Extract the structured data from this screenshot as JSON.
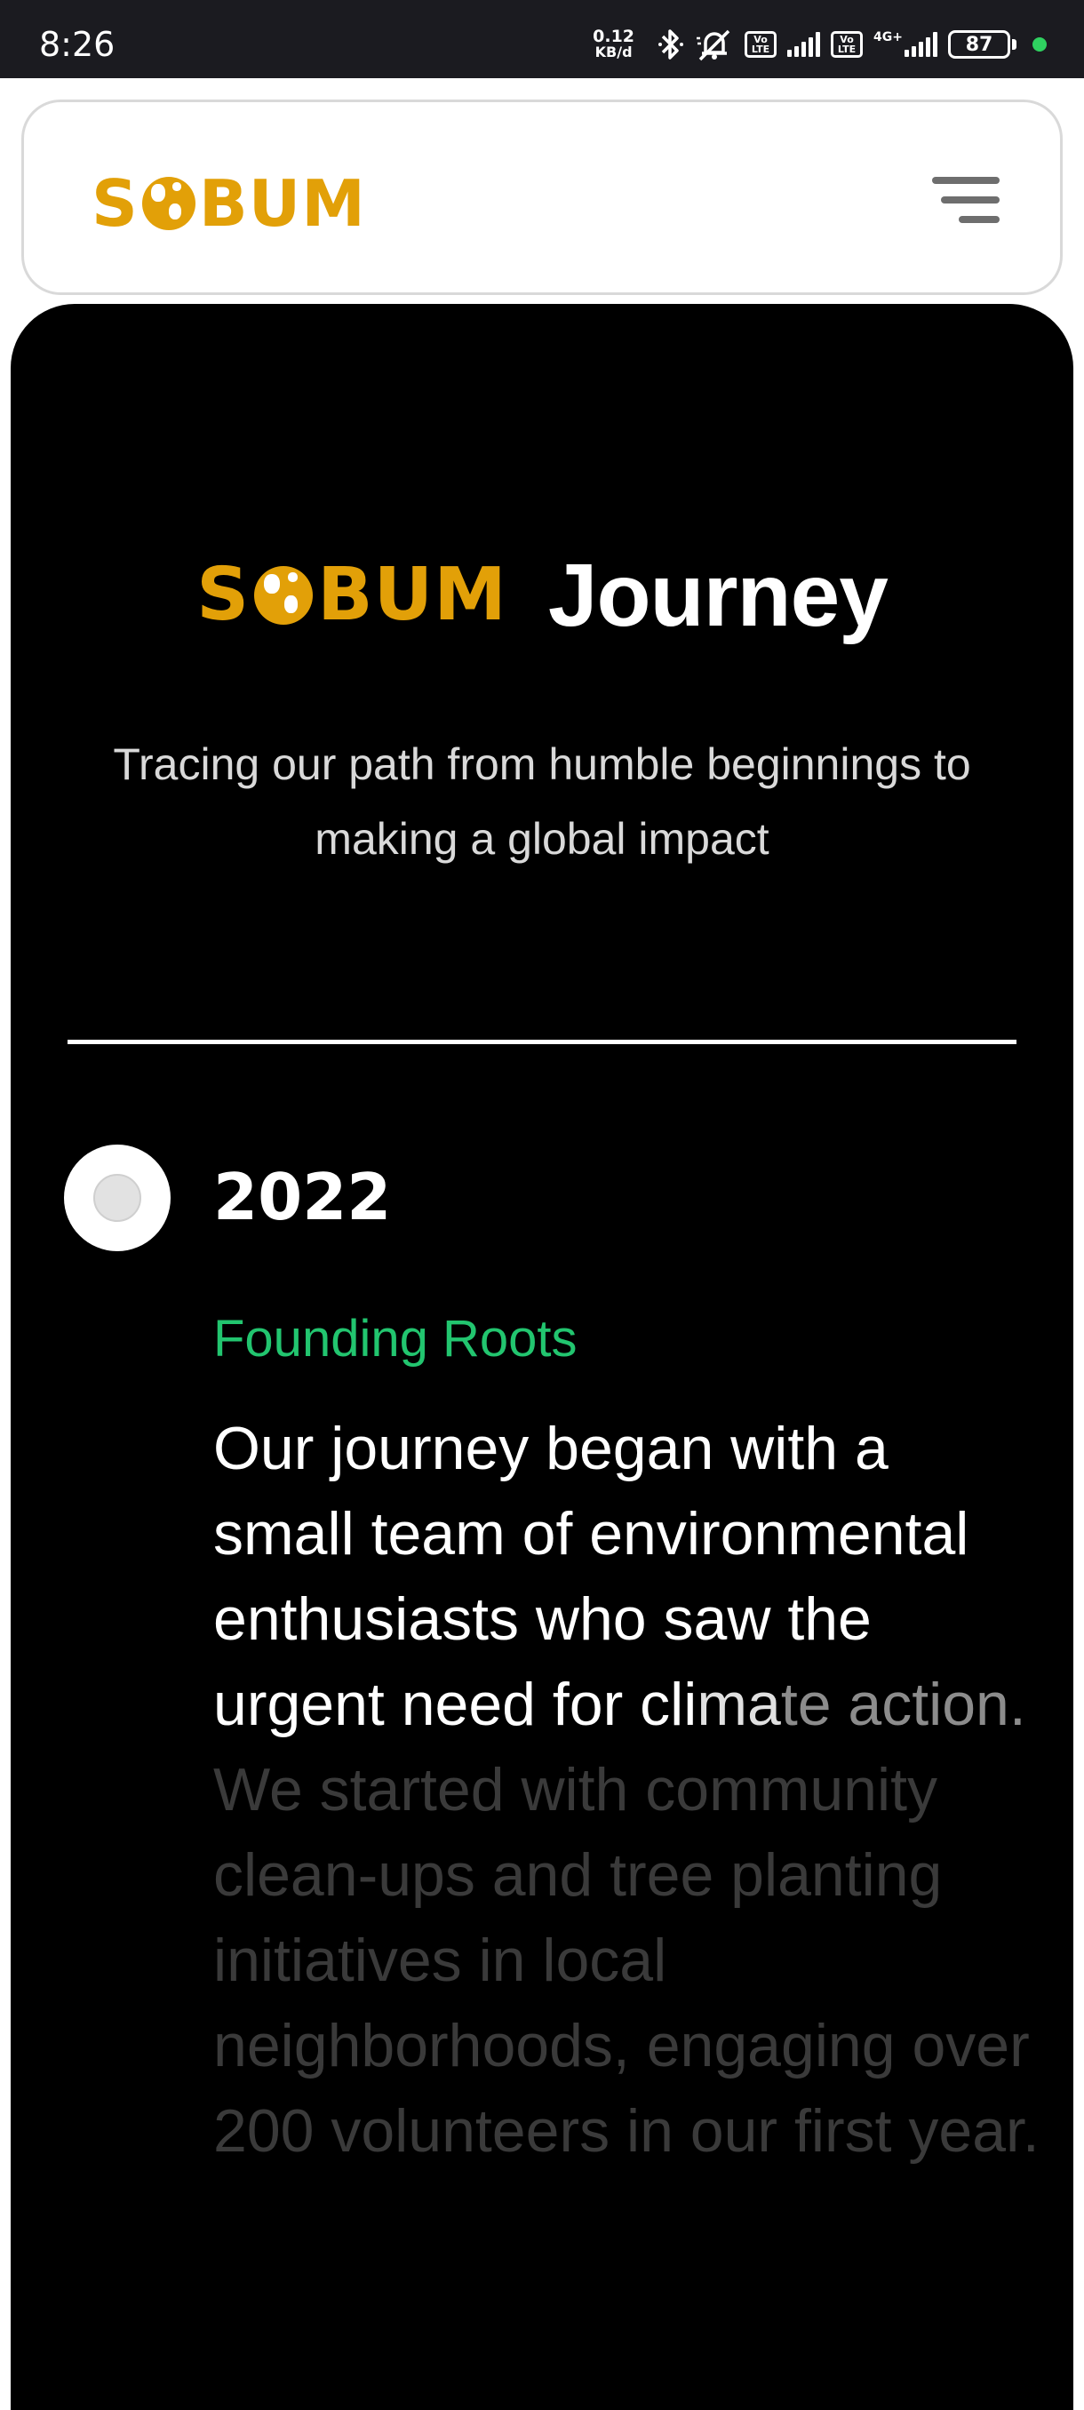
{
  "status_bar": {
    "time": "8:26",
    "net_speed_value": "0.12",
    "net_speed_unit": "KB/d",
    "volte_label": "Vo LTE",
    "network_type": "4G+",
    "battery": "87",
    "dot_color": "#2fd160"
  },
  "header": {
    "logo_text_left": "S",
    "logo_text_right": "BUM",
    "menu_icon": "hamburger-menu-icon"
  },
  "hero": {
    "logo_text_left": "S",
    "logo_text_right": "BUM",
    "title": "Journey",
    "subtitle": "Tracing our path from humble beginnings to making a global impact"
  },
  "timeline": {
    "items": [
      {
        "year": "2022",
        "title": "Founding Roots",
        "description_parts": [
          "Our journey began with a small team of environmental enthusiasts who saw the urgent need for cli",
          "ma",
          "te action.",
          " We started with community clean-ups and tree planting initiatives in local neighborhoods, engaging over 200 volunteers in our first year."
        ]
      }
    ]
  },
  "colors": {
    "brand_gold": "#e2a008",
    "accent_green": "#22c56f",
    "panel_bg": "#000000"
  }
}
